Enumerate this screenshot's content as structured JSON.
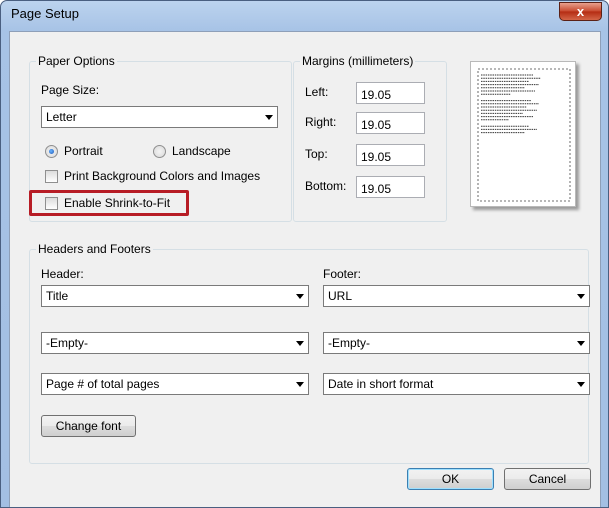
{
  "window": {
    "title": "Page Setup",
    "close_label": "x"
  },
  "paper_options": {
    "legend": "Paper Options",
    "page_size_label": "Page Size:",
    "page_size_value": "Letter",
    "portrait_label": "Portrait",
    "landscape_label": "Landscape",
    "orientation_selected": "Portrait",
    "print_background_label": "Print Background Colors and Images",
    "print_background_checked": false,
    "shrink_label": "Enable Shrink-to-Fit",
    "shrink_checked": false
  },
  "margins": {
    "legend": "Margins (millimeters)",
    "left_label": "Left:",
    "left_value": "19.05",
    "right_label": "Right:",
    "right_value": "19.05",
    "top_label": "Top:",
    "top_value": "19.05",
    "bottom_label": "Bottom:",
    "bottom_value": "19.05"
  },
  "headers_footers": {
    "legend": "Headers and Footers",
    "header_label": "Header:",
    "footer_label": "Footer:",
    "header": [
      "Title",
      "-Empty-",
      "Page # of total pages"
    ],
    "footer": [
      "URL",
      "-Empty-",
      "Date in short format"
    ],
    "change_font_label": "Change font"
  },
  "buttons": {
    "ok": "OK",
    "cancel": "Cancel"
  },
  "colors": {
    "highlight": "#b71c25",
    "window_frame": "#a7c3e6",
    "close_button": "#c7472c"
  }
}
